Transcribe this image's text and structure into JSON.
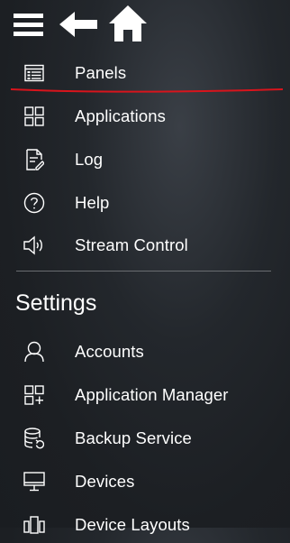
{
  "toolbar": {
    "menu_icon": "hamburger-menu-icon",
    "back_icon": "back-arrow-icon",
    "home_icon": "home-icon"
  },
  "menu": {
    "items": [
      {
        "label": "Panels",
        "icon": "panels-icon"
      },
      {
        "label": "Applications",
        "icon": "applications-grid-icon"
      },
      {
        "label": "Log",
        "icon": "log-document-icon"
      },
      {
        "label": "Help",
        "icon": "help-question-icon"
      },
      {
        "label": "Stream Control",
        "icon": "speaker-icon"
      }
    ]
  },
  "settings": {
    "title": "Settings",
    "items": [
      {
        "label": "Accounts",
        "icon": "person-icon"
      },
      {
        "label": "Application Manager",
        "icon": "application-manager-icon"
      },
      {
        "label": "Backup Service",
        "icon": "database-backup-icon"
      },
      {
        "label": "Devices",
        "icon": "monitor-icon"
      },
      {
        "label": "Device Layouts",
        "icon": "device-layouts-icon"
      }
    ]
  },
  "colors": {
    "background": "#1c1f23",
    "text": "#ffffff",
    "divider": "#6a6d71",
    "annotation_underline": "#d8141c"
  }
}
